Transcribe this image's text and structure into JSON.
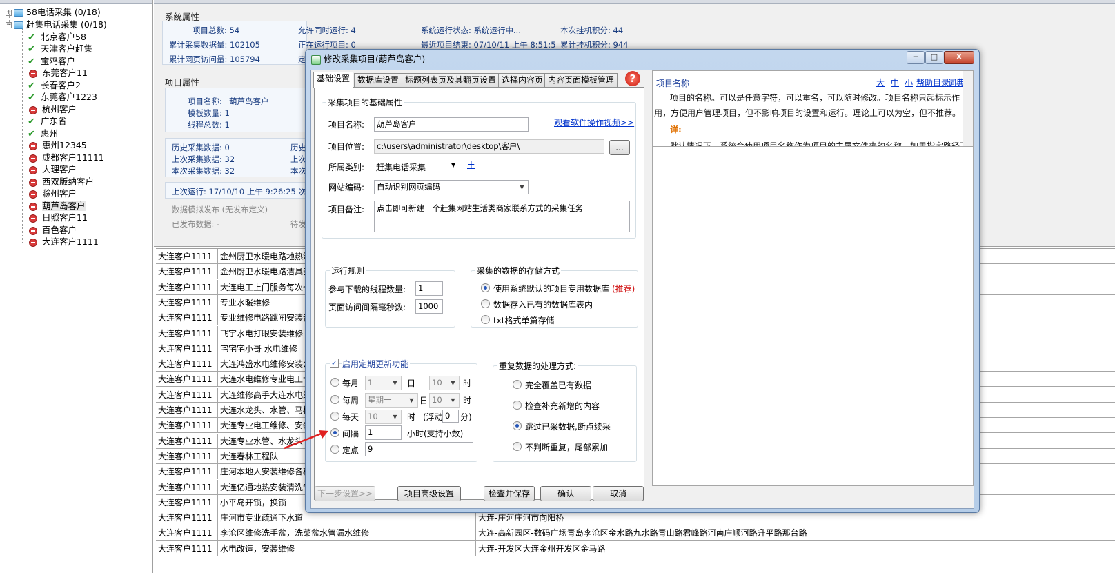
{
  "tree": {
    "nodes": [
      {
        "label": "58电话采集 (0/18)",
        "icon": "folder-icon",
        "exp": "+"
      },
      {
        "label": "赶集电话采集 (0/18)",
        "icon": "folder-icon",
        "exp": "−"
      },
      {
        "label": "北京客户58",
        "icon": "check-icon"
      },
      {
        "label": "天津客户赶集",
        "icon": "check-icon"
      },
      {
        "label": "宝鸡客户",
        "icon": "check-icon"
      },
      {
        "label": "东莞客户11",
        "icon": "stop-icon"
      },
      {
        "label": "长春客户2",
        "icon": "check-icon"
      },
      {
        "label": "东莞客户1223",
        "icon": "check-icon"
      },
      {
        "label": "杭州客户",
        "icon": "stop-icon"
      },
      {
        "label": "广东省",
        "icon": "check-icon"
      },
      {
        "label": "惠州",
        "icon": "check-icon"
      },
      {
        "label": "惠州12345",
        "icon": "stop-icon"
      },
      {
        "label": "成都客户11111",
        "icon": "stop-icon"
      },
      {
        "label": "大理客户",
        "icon": "stop-icon"
      },
      {
        "label": "西双版纳客户",
        "icon": "stop-icon"
      },
      {
        "label": "滁州客户",
        "icon": "stop-icon"
      },
      {
        "label": "葫芦岛客户",
        "icon": "stop-icon"
      },
      {
        "label": "日照客户11",
        "icon": "stop-icon"
      },
      {
        "label": "百色客户",
        "icon": "stop-icon"
      },
      {
        "label": "大连客户1111",
        "icon": "stop-icon"
      }
    ]
  },
  "system_props": {
    "title": "系统属性",
    "total_projects": "项目总数: 54",
    "allow_concurrent": "允许同时运行: 4",
    "run_status": "系统运行状态: 系统运行中...",
    "hang_points": "本次挂机积分: 44",
    "total_collected": "累计采集数据量: 102105",
    "running_projects": "正在运行项目: 0",
    "last_finished": "最近项目结束: 07/10/11 上午 8:51:5",
    "total_hang_points": "累计挂机积分: 944",
    "total_visits": "累计网页访问量: 105794",
    "trunc": "定"
  },
  "project_props": {
    "title": "项目属性",
    "name_label": "项目名称:",
    "name_value": "葫芦岛客户",
    "template_count": "模板数量: 1",
    "thread_total": "线程总数: 1",
    "history": "历史采集数据: 0",
    "history2": "历史",
    "last": "上次采集数据: 32",
    "last2": "上次",
    "current": "本次采集数据: 32",
    "current2": "本次",
    "last_run": "上次运行: 17/10/10 上午 9:26:25 次",
    "publish_title": "数据模拟发布 (无发布定义)",
    "published": "已发布数据: -",
    "pending": "待发"
  },
  "grid": {
    "rows": [
      [
        "大连客户1111",
        "金州厨卫水暖电路地热清",
        ""
      ],
      [
        "大连客户1111",
        "金州厨卫水暖电路洁具安",
        ""
      ],
      [
        "大连客户1111",
        "大连电工上门服务每次七",
        ""
      ],
      [
        "大连客户1111",
        "专业水暖维修",
        ""
      ],
      [
        "大连客户1111",
        "专业维修电路跳闸安装音",
        ""
      ],
      [
        "大连客户1111",
        "飞宇水电打眼安装维修",
        ""
      ],
      [
        "大连客户1111",
        "宅宅宅小哥 水电维修",
        ""
      ],
      [
        "大连客户1111",
        "大连鸿盛水电维修安装公",
        ""
      ],
      [
        "大连客户1111",
        "大连水电维修专业电工专",
        ""
      ],
      [
        "大连客户1111",
        "大连维修高手大连水电维",
        ""
      ],
      [
        "大连客户1111",
        "大连水龙头、水管、马桶",
        ""
      ],
      [
        "大连客户1111",
        "大连专业电工维修、安装",
        ""
      ],
      [
        "大连客户1111",
        "大连专业水管、水龙头",
        ""
      ],
      [
        "大连客户1111",
        "大连春林工程队",
        ""
      ],
      [
        "大连客户1111",
        "庄河本地人安装维修各种",
        ""
      ],
      [
        "大连客户1111",
        "大连亿通地热安装清洗专",
        ""
      ],
      [
        "大连客户1111",
        "小平岛开锁，换锁",
        ""
      ],
      [
        "大连客户1111",
        "庄河市专业疏通下水道",
        "大连-庄河庄河市向阳桥"
      ],
      [
        "大连客户1111",
        "李沧区维修洗手盆，洗菜盆水管漏水维修",
        "大连-高新园区-数码广场青岛李沧区金水路九水路青山路君峰路河南庄顺河路升平路那台路"
      ],
      [
        "大连客户1111",
        "水电改造，安装维修",
        "大连-开发区大连金州开发区金马路"
      ]
    ]
  },
  "dialog": {
    "title": "修改采集项目(葫芦岛客户)",
    "min": "─",
    "max": "□",
    "close": "X",
    "tabs": [
      "基础设置",
      "数据库设置",
      "标题列表页及其翻页设置",
      "选择内容页",
      "内容页面模板管理"
    ],
    "basic": {
      "legend": "采集项目的基础属性",
      "name_label": "项目名称:",
      "name_value": "葫芦岛客户",
      "video_link": "观看软件操作视频>>",
      "location_label": "项目位置:",
      "location_value": "c:\\users\\administrator\\desktop\\客户\\",
      "browse": "...",
      "category_label": "所属类别:",
      "category_value": "赶集电话采集",
      "add": "+",
      "encoding_label": "网站编码:",
      "encoding_value": "自动识别网页编码",
      "note_label": "项目备注:",
      "note_value": "点击即可新建一个赶集网站生活类商家联系方式的采集任务"
    },
    "run_rules": {
      "legend": "运行规则",
      "threads_label": "参与下载的线程数量:",
      "threads_value": "1",
      "interval_label": "页面访问间隔毫秒数:",
      "interval_value": "1000"
    },
    "storage": {
      "legend": "采集的数据的存储方式",
      "opt1": "使用系统默认的项目专用数据库",
      "recommend": "(推荐)",
      "opt2": "数据存入已有的数据库表内",
      "opt3": "txt格式单篇存储"
    },
    "schedule": {
      "enable_label": "启用定期更新功能",
      "monthly": "每月",
      "monthly_day": "1",
      "day_label": "日",
      "monthly_hour": "10",
      "hour_label": "时",
      "weekly": "每周",
      "weekly_day": "星期一",
      "weekly_hour": "10",
      "daily": "每天",
      "daily_hour": "10",
      "float_label": "(浮动",
      "float_value": "0",
      "minute_label": "分)",
      "interval": "间隔",
      "interval_value": "1",
      "interval_unit": "小时(支持小数)",
      "fixed": "定点",
      "fixed_value": "9"
    },
    "dup": {
      "legend": "重复数据的处理方式:",
      "opt1": "完全覆盖已有数据",
      "opt2": "检查补充新增的内容",
      "opt3": "跳过已采数据,断点续采",
      "opt4": "不判断重复，尾部累加"
    },
    "buttons": {
      "next": "下一步设置>>",
      "advanced": "项目高级设置",
      "check_save": "检查并保存",
      "ok": "确认",
      "cancel": "取消"
    },
    "help": {
      "title": "项目名称",
      "size_large": "大",
      "size_mid": "中",
      "size_small": "小",
      "help_index": "帮助目录",
      "dictionary": "词典",
      "line1": "项目的名称。可以是任意字符，可以重名，可以随时修改。项目名称只起标示作",
      "line2": "用，方便用户管理项目，但不影响项目的设置和运行。理论上可以为空，但不推荐。",
      "detail": "详:",
      "line3": "默认情况下，系统会使用项目名称作为项目的主属文件夹的名称，如果指定路径下"
    }
  }
}
